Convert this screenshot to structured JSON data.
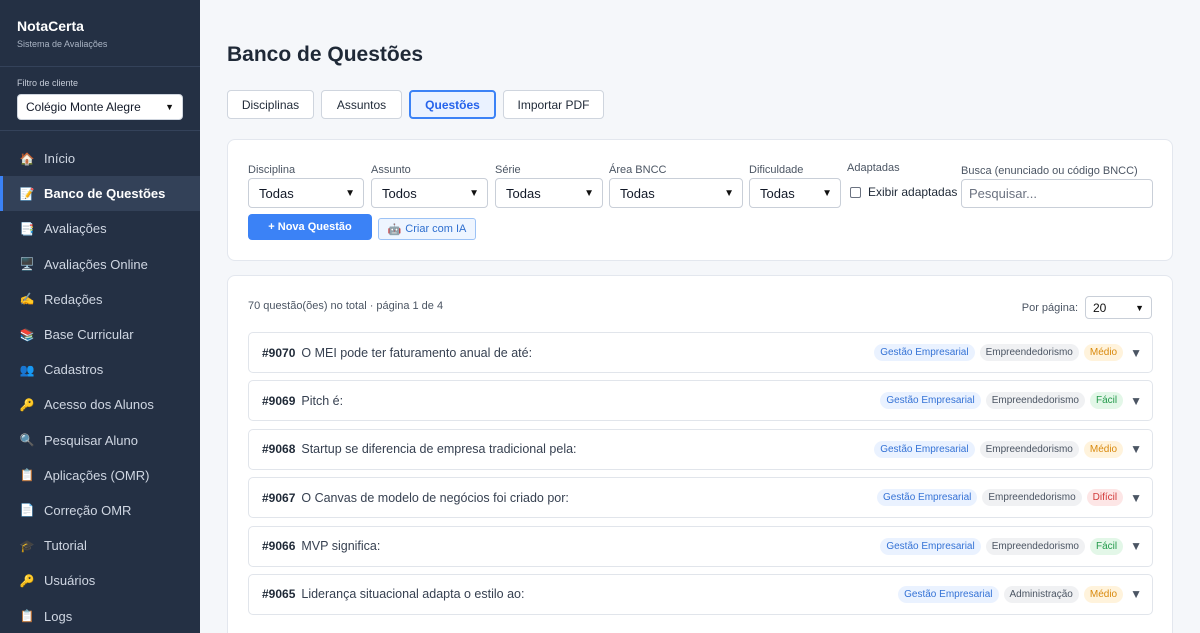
{
  "brand": {
    "title": "NotaCerta",
    "subtitle": "Sistema de Avaliações"
  },
  "client_filter": {
    "label": "Filtro de cliente",
    "value": "Colégio Monte Alegre"
  },
  "nav": [
    {
      "label": "Início",
      "icon": "🏠",
      "icon_name": "home-icon",
      "active": false
    },
    {
      "label": "Banco de Questões",
      "icon": "📝",
      "icon_name": "memo-icon",
      "active": true
    },
    {
      "label": "Avaliações",
      "icon": "📑",
      "icon_name": "bookmark-tabs-icon",
      "active": false
    },
    {
      "label": "Avaliações Online",
      "icon": "🖥️",
      "icon_name": "desktop-icon",
      "active": false
    },
    {
      "label": "Redações",
      "icon": "✍️",
      "icon_name": "writing-hand-icon",
      "active": false
    },
    {
      "label": "Base Curricular",
      "icon": "📚",
      "icon_name": "books-icon",
      "active": false
    },
    {
      "label": "Cadastros",
      "icon": "👥",
      "icon_name": "users-icon",
      "active": false
    },
    {
      "label": "Acesso dos Alunos",
      "icon": "🔑",
      "icon_name": "key-icon",
      "active": false
    },
    {
      "label": "Pesquisar Aluno",
      "icon": "🔍",
      "icon_name": "search-icon",
      "active": false
    },
    {
      "label": "Aplicações (OMR)",
      "icon": "📋",
      "icon_name": "clipboard-icon",
      "active": false
    },
    {
      "label": "Correção OMR",
      "icon": "📄",
      "icon_name": "document-icon",
      "active": false
    },
    {
      "label": "Tutorial",
      "icon": "🎓",
      "icon_name": "graduation-cap-icon",
      "active": false
    },
    {
      "label": "Usuários",
      "icon": "🔑",
      "icon_name": "key-icon",
      "active": false
    },
    {
      "label": "Logs",
      "icon": "📋",
      "icon_name": "clipboard-icon",
      "active": false
    }
  ],
  "page_title": "Banco de Questões",
  "tabs": [
    {
      "label": "Disciplinas",
      "active": false
    },
    {
      "label": "Assuntos",
      "active": false
    },
    {
      "label": "Questões",
      "active": true
    },
    {
      "label": "Importar PDF",
      "active": false
    }
  ],
  "filters": {
    "disciplina": {
      "label": "Disciplina",
      "value": "Todas"
    },
    "assunto": {
      "label": "Assunto",
      "value": "Todos"
    },
    "serie": {
      "label": "Série",
      "value": "Todas"
    },
    "area_bncc": {
      "label": "Área BNCC",
      "value": "Todas"
    },
    "dificuldade": {
      "label": "Dificuldade",
      "value": "Todas"
    },
    "adaptadas": {
      "label": "Adaptadas",
      "checkbox_label": "Exibir adaptadas",
      "checked": false
    },
    "busca": {
      "label": "Busca (enunciado ou código BNCC)",
      "placeholder": "Pesquisar..."
    }
  },
  "actions": {
    "new_question": "+ Nova Questão",
    "create_ai": "Criar com IA",
    "create_ai_icon": "🤖"
  },
  "list": {
    "summary": "70 questão(ões) no total · página 1 de 4",
    "per_page_label": "Por página:",
    "per_page_value": "20",
    "questions": [
      {
        "id": "#9070",
        "text": "O MEI pode ter faturamento anual de até:",
        "subject": "Gestão Empresarial",
        "topic": "Empreendedorismo",
        "difficulty": "Médio",
        "level": "medium"
      },
      {
        "id": "#9069",
        "text": "Pitch é:",
        "subject": "Gestão Empresarial",
        "topic": "Empreendedorismo",
        "difficulty": "Fácil",
        "level": "easy"
      },
      {
        "id": "#9068",
        "text": "Startup se diferencia de empresa tradicional pela:",
        "subject": "Gestão Empresarial",
        "topic": "Empreendedorismo",
        "difficulty": "Médio",
        "level": "medium"
      },
      {
        "id": "#9067",
        "text": "O Canvas de modelo de negócios foi criado por:",
        "subject": "Gestão Empresarial",
        "topic": "Empreendedorismo",
        "difficulty": "Difícil",
        "level": "hard"
      },
      {
        "id": "#9066",
        "text": "MVP significa:",
        "subject": "Gestão Empresarial",
        "topic": "Empreendedorismo",
        "difficulty": "Fácil",
        "level": "easy"
      },
      {
        "id": "#9065",
        "text": "Liderança situacional adapta o estilo ao:",
        "subject": "Gestão Empresarial",
        "topic": "Administração",
        "difficulty": "Médio",
        "level": "medium"
      }
    ]
  }
}
